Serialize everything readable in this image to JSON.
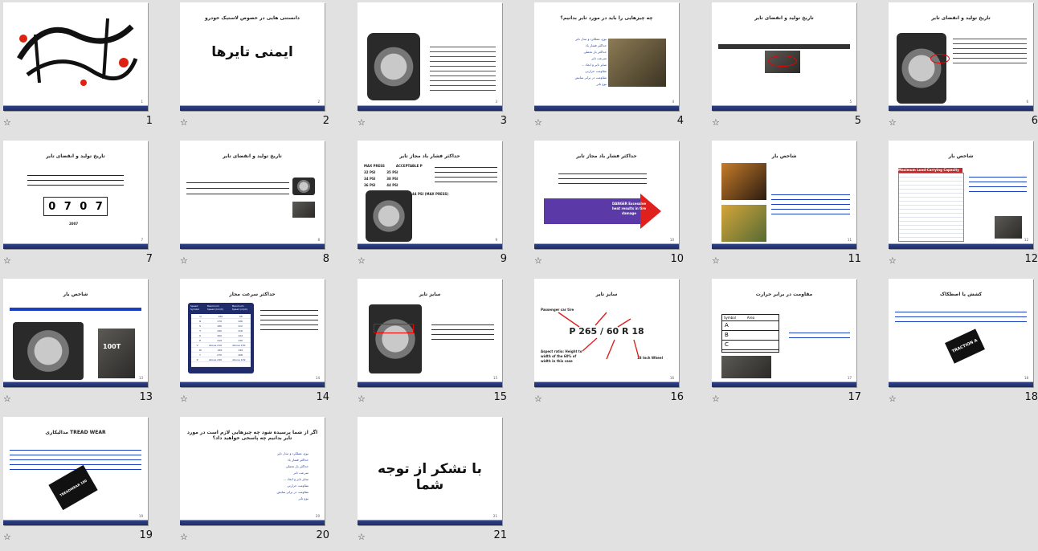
{
  "slides": [
    {
      "n": "1",
      "title": "",
      "heading": "",
      "type": "calligraphy"
    },
    {
      "n": "2",
      "title": "دانستنی هایی در خصوص لاستیک خودرو",
      "heading": "ایمنی تایرها"
    },
    {
      "n": "3",
      "title": "",
      "heading": "",
      "type": "photo-text"
    },
    {
      "n": "4",
      "title": "چه چیزهایی را باید در مورد تایر بدانیم؟",
      "heading": "",
      "type": "list"
    },
    {
      "n": "5",
      "title": "تاریخ تولید و انقضای تایر",
      "heading": "",
      "type": "oval"
    },
    {
      "n": "6",
      "title": "تاریخ تولید و انقضای تایر",
      "heading": "",
      "type": "photo-right"
    },
    {
      "n": "7",
      "title": "تاریخ تولید و انقضای تایر",
      "heading": "",
      "type": "code",
      "code_digits": [
        "0",
        "7",
        "0",
        "7"
      ],
      "code_year": "2007"
    },
    {
      "n": "8",
      "title": "تاریخ تولید و انقضای تایر",
      "heading": "",
      "type": "text-photo"
    },
    {
      "n": "9",
      "title": "حداکثر فشار باد مجاز تایر",
      "heading": "",
      "type": "pressure",
      "pressure_rows": [
        [
          "MAX PRESS",
          "ACCEPTABLE P"
        ],
        [
          "32 PSI",
          "35 PSI"
        ],
        [
          "34 PSI",
          "38 PSI"
        ],
        [
          "36 PSI",
          "44 PSI"
        ]
      ],
      "pressure_note": "44 PSI (MAX PRESS)"
    },
    {
      "n": "10",
      "title": "حداکثر فشار باد مجاز تایر",
      "heading": "",
      "type": "danger",
      "danger_text": "DANGER Excessive heat results in tire damage"
    },
    {
      "n": "11",
      "title": "شاخص بار",
      "heading": "",
      "type": "load-photos"
    },
    {
      "n": "12",
      "title": "شاخص بار",
      "heading": "",
      "type": "load-table",
      "table_caption": "Maximum Load-Carrying Capacity Per Tire"
    },
    {
      "n": "13",
      "title": "شاخص بار",
      "heading": "",
      "type": "two-tires",
      "tire_code": "100T"
    },
    {
      "n": "14",
      "title": "حداکثر سرعت مجاز",
      "heading": "",
      "type": "speed-table",
      "speed_headers": [
        "Speed Symbol",
        "Maximum Speed (km/h)",
        "Maximum Speed (mph)"
      ],
      "speed_rows": [
        [
          "Q",
          "160",
          "99"
        ],
        [
          "R",
          "170",
          "106"
        ],
        [
          "S",
          "180",
          "112"
        ],
        [
          "T",
          "190",
          "118"
        ],
        [
          "U",
          "200",
          "124"
        ],
        [
          "H",
          "210",
          "130"
        ],
        [
          "V",
          "Above 210",
          "Above 130"
        ],
        [
          "W",
          "240",
          "149"
        ],
        [
          "Y",
          "270",
          "168"
        ],
        [
          "Z",
          "Above 240",
          "Above 149"
        ]
      ]
    },
    {
      "n": "15",
      "title": "سایز تایر",
      "heading": "",
      "type": "size-photo"
    },
    {
      "n": "16",
      "title": "سایز تایر",
      "heading": "",
      "type": "size-code",
      "size_code": "P 265 / 60 R 18",
      "size_labels": [
        "Passenger car tire",
        "Aspect ratio: Height to width of the 60% of width in this case",
        "18 Inch Wheel"
      ]
    },
    {
      "n": "17",
      "title": "مقاومت در برابر حرارت",
      "heading": "",
      "type": "grade",
      "grade_header": [
        "Symbol",
        "Area"
      ],
      "grade_rows": [
        "A",
        "B",
        "C"
      ]
    },
    {
      "n": "18",
      "title": "کشش یا اصطکاک",
      "heading": "",
      "type": "traction",
      "traction_text": "TRACTION A"
    },
    {
      "n": "19",
      "title": "TREAD WEAR مدالیکاری",
      "heading": "",
      "type": "treadwear",
      "tread_text": "TREADWEAR 180"
    },
    {
      "n": "20",
      "title": "اگر از شما پرسیده شود چه چیزهایی لازم است در مورد تایر بدانیم چه پاسخی خواهید داد؟",
      "heading": "",
      "type": "list"
    },
    {
      "n": "21",
      "title": "",
      "heading": "با تشکر از توجه شما",
      "type": "thanks"
    }
  ],
  "list_items": [
    "نوع، عملکرد و مدل تایر",
    "حداکثر فشار باد",
    "حداکثر بار تحملی",
    "سرعت تایر",
    "سایز تایر و ابعاد ...",
    "مقاومت حرارتی",
    "مقاومت در برابر سایش",
    "نوع تایر"
  ],
  "colors": {
    "bar": "#1f2d66",
    "accent": "#d9a441",
    "link": "#1a3fc0",
    "danger": "#e0201d"
  },
  "icons": {
    "star": "star-outline-icon"
  }
}
